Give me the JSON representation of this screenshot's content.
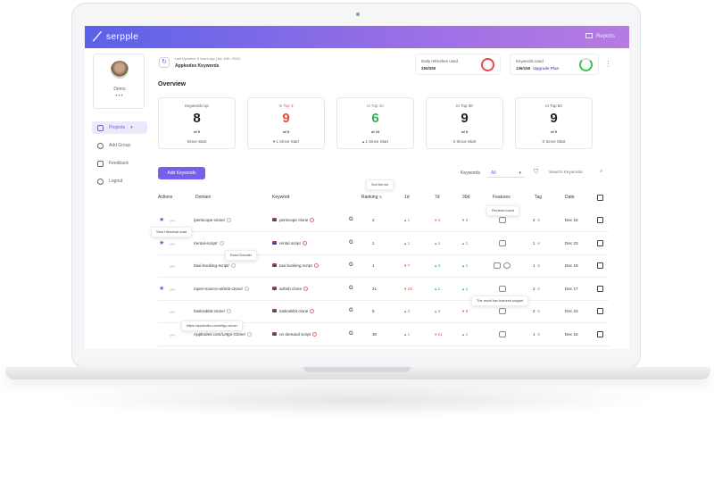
{
  "app": {
    "brand": "serpple",
    "reports_label": "Reports"
  },
  "user": {
    "name": "Demo",
    "menu_dots": "•••"
  },
  "sidebar": {
    "items": [
      {
        "label": "Projects",
        "icon": "layers-icon"
      },
      {
        "label": "Add Group",
        "icon": "plus-circle-icon"
      },
      {
        "label": "Feedback",
        "icon": "feedback-icon"
      },
      {
        "label": "Logout",
        "icon": "power-icon"
      }
    ]
  },
  "header": {
    "last_updated": "Last Updated: 8 hours ago (Jan 19th, 2020)",
    "project_name": "Appkodes Keywords",
    "daily_refreshes": {
      "label": "Daily refreshes used",
      "value": "250/250",
      "ring_color": "#e24a4a"
    },
    "keywords_used": {
      "label": "Keywords used",
      "value": "136/150",
      "link": "Upgrade Plan",
      "ring_color": "#3bbf4f"
    }
  },
  "overview": {
    "title": "Overview",
    "cards": [
      {
        "title": "Keywords Up",
        "value": "8",
        "of": "of 9",
        "since": "Since Start",
        "color": "#222222"
      },
      {
        "title": "In Top 3",
        "value": "9",
        "of": "of 9",
        "since": "▾ 1 Since Start",
        "color": "#e2503c"
      },
      {
        "title": "In Top 10",
        "value": "6",
        "of": "of 10",
        "since": "▴ 1 Since Start",
        "color": "#2bb24c"
      },
      {
        "title": "In Top 30",
        "value": "9",
        "of": "of 9",
        "since": "0 Since Start",
        "color": "#222222"
      },
      {
        "title": "In Top 50",
        "value": "9",
        "of": "of 9",
        "since": "0 Since Start",
        "color": "#222222"
      }
    ]
  },
  "toolbar": {
    "add_button": "Add Keywords",
    "filter_label": "Keywords",
    "filter_value": "All",
    "search_placeholder": "Search Keywords"
  },
  "table": {
    "headers": {
      "actions": "Actions",
      "domain": "Domain",
      "keyword": "Keyword",
      "ranking": "Ranking",
      "d1": "1d",
      "d7": "7d",
      "d30": "30d",
      "features": "Features",
      "tag": "Tag",
      "date": "Date"
    },
    "rows": [
      {
        "starred": true,
        "domain": "/periscope-clone/",
        "keyword": "periscope clone",
        "ranking": "2",
        "d1": "▴ 1",
        "d1_dir": "up",
        "d7": "▾ 4",
        "d7_dir": "down",
        "d30": "▾ 3",
        "d30_dir": "down",
        "features": 1,
        "tag": "2",
        "date": "Dec 16"
      },
      {
        "starred": true,
        "domain": "/rental-script/",
        "keyword": "rental script",
        "ranking": "1",
        "d1": "▴ 1",
        "d1_dir": "up",
        "d7": "▴ 1",
        "d7_dir": "up",
        "d30": "▴ 1",
        "d30_dir": "up",
        "features": 1,
        "tag": "1",
        "date": "Dec 23"
      },
      {
        "starred": false,
        "domain": "/taxi-booking-script/",
        "keyword": "taxi booking script",
        "ranking": "1",
        "d1": "▾ 7",
        "d1_dir": "down",
        "d7": "▴ 4",
        "d7_dir": "up",
        "d30": "▴ 1",
        "d30_dir": "up",
        "features": 2,
        "tag": "1",
        "date": "Dec 18"
      },
      {
        "starred": true,
        "domain": "/open-source-airbnb-clone/",
        "keyword": "airbnb clone",
        "ranking": "21",
        "d1": "▾ 19",
        "d1_dir": "down",
        "d7": "▴ 1",
        "d7_dir": "up",
        "d30": "▴ 1",
        "d30_dir": "up",
        "features": 1,
        "tag": "2",
        "date": "Dec 17"
      },
      {
        "starred": false,
        "domain": "/taskrabbit-clone/",
        "keyword": "taskrabbit clone",
        "ranking": "5",
        "d1": "▴ 4",
        "d1_dir": "up",
        "d7": "▴ 3",
        "d7_dir": "up",
        "d30": "▾ 9",
        "d30_dir": "down",
        "features": 1,
        "tag": "2",
        "date": "Dec 23"
      },
      {
        "starred": false,
        "domain": "Appkodes.com/Letgo-Clone/",
        "keyword": "on demand script",
        "ranking": "30",
        "d1": "▴ 1",
        "d1_dir": "up",
        "d7": "▾ 21",
        "d7_dir": "down",
        "d30": "▴ 1",
        "d30_dir": "up",
        "features": 1,
        "tag": "1",
        "date": "Dec 16"
      }
    ]
  },
  "tooltips": {
    "sort": "Sort the list",
    "reviews": "Reviews found",
    "history": "View Historical chart",
    "exact": "Exact Domain",
    "featured": "The result has featured snippet",
    "url": "https://appkodes.com/letgo-clone/"
  },
  "colors": {
    "accent": "#7460ea",
    "up": "#2bb24c",
    "down": "#e2503c"
  }
}
